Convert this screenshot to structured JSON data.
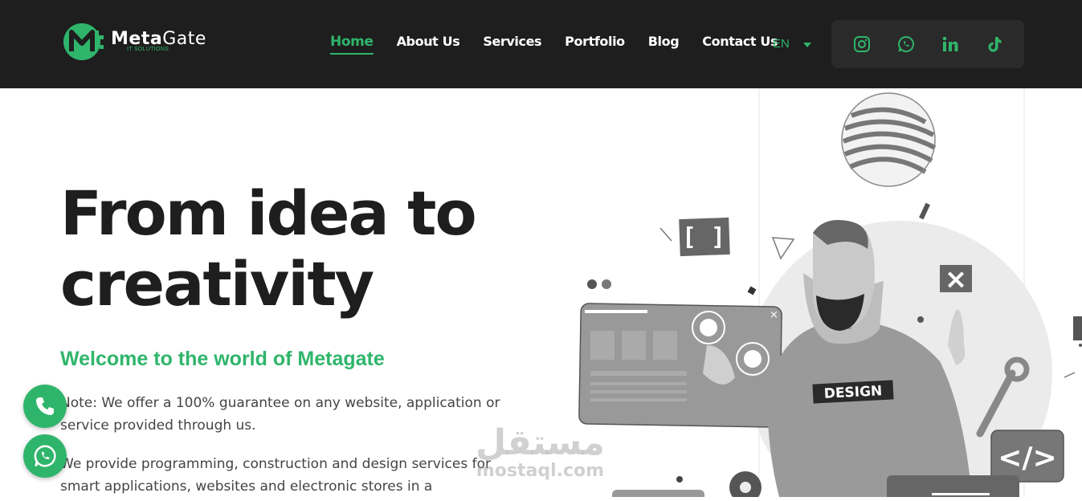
{
  "header": {
    "logo": {
      "name_meta": "Meta",
      "name_gate": "Gate",
      "subtitle": "IT SOLUTIONS"
    },
    "nav": [
      {
        "label": "Home",
        "active": true
      },
      {
        "label": "About Us",
        "active": false
      },
      {
        "label": "Services",
        "active": false
      },
      {
        "label": "Portfolio",
        "active": false
      },
      {
        "label": "Blog",
        "active": false
      },
      {
        "label": "Contact Us",
        "active": false
      }
    ],
    "language": "EN",
    "social": [
      "instagram-icon",
      "whatsapp-icon",
      "linkedin-icon",
      "tiktok-icon"
    ]
  },
  "hero": {
    "title_line1": "From idea to",
    "title_line2": "creativity",
    "welcome": "Welcome to the world of Metagate",
    "paragraph1": "Note: We offer a 100% guarantee on any website, application or service provided through us.",
    "paragraph2": "We provide programming, construction and design services for smart applications, websites and electronic stores in a"
  },
  "illustration": {
    "shirt_text": "DESIGN",
    "bracket_text": "[ ]",
    "code_text": "</>"
  },
  "watermark": {
    "arabic": "مستقل",
    "latin": "mostaql.com"
  },
  "colors": {
    "accent": "#2fb56b",
    "header_bg": "#1e1e1e"
  }
}
